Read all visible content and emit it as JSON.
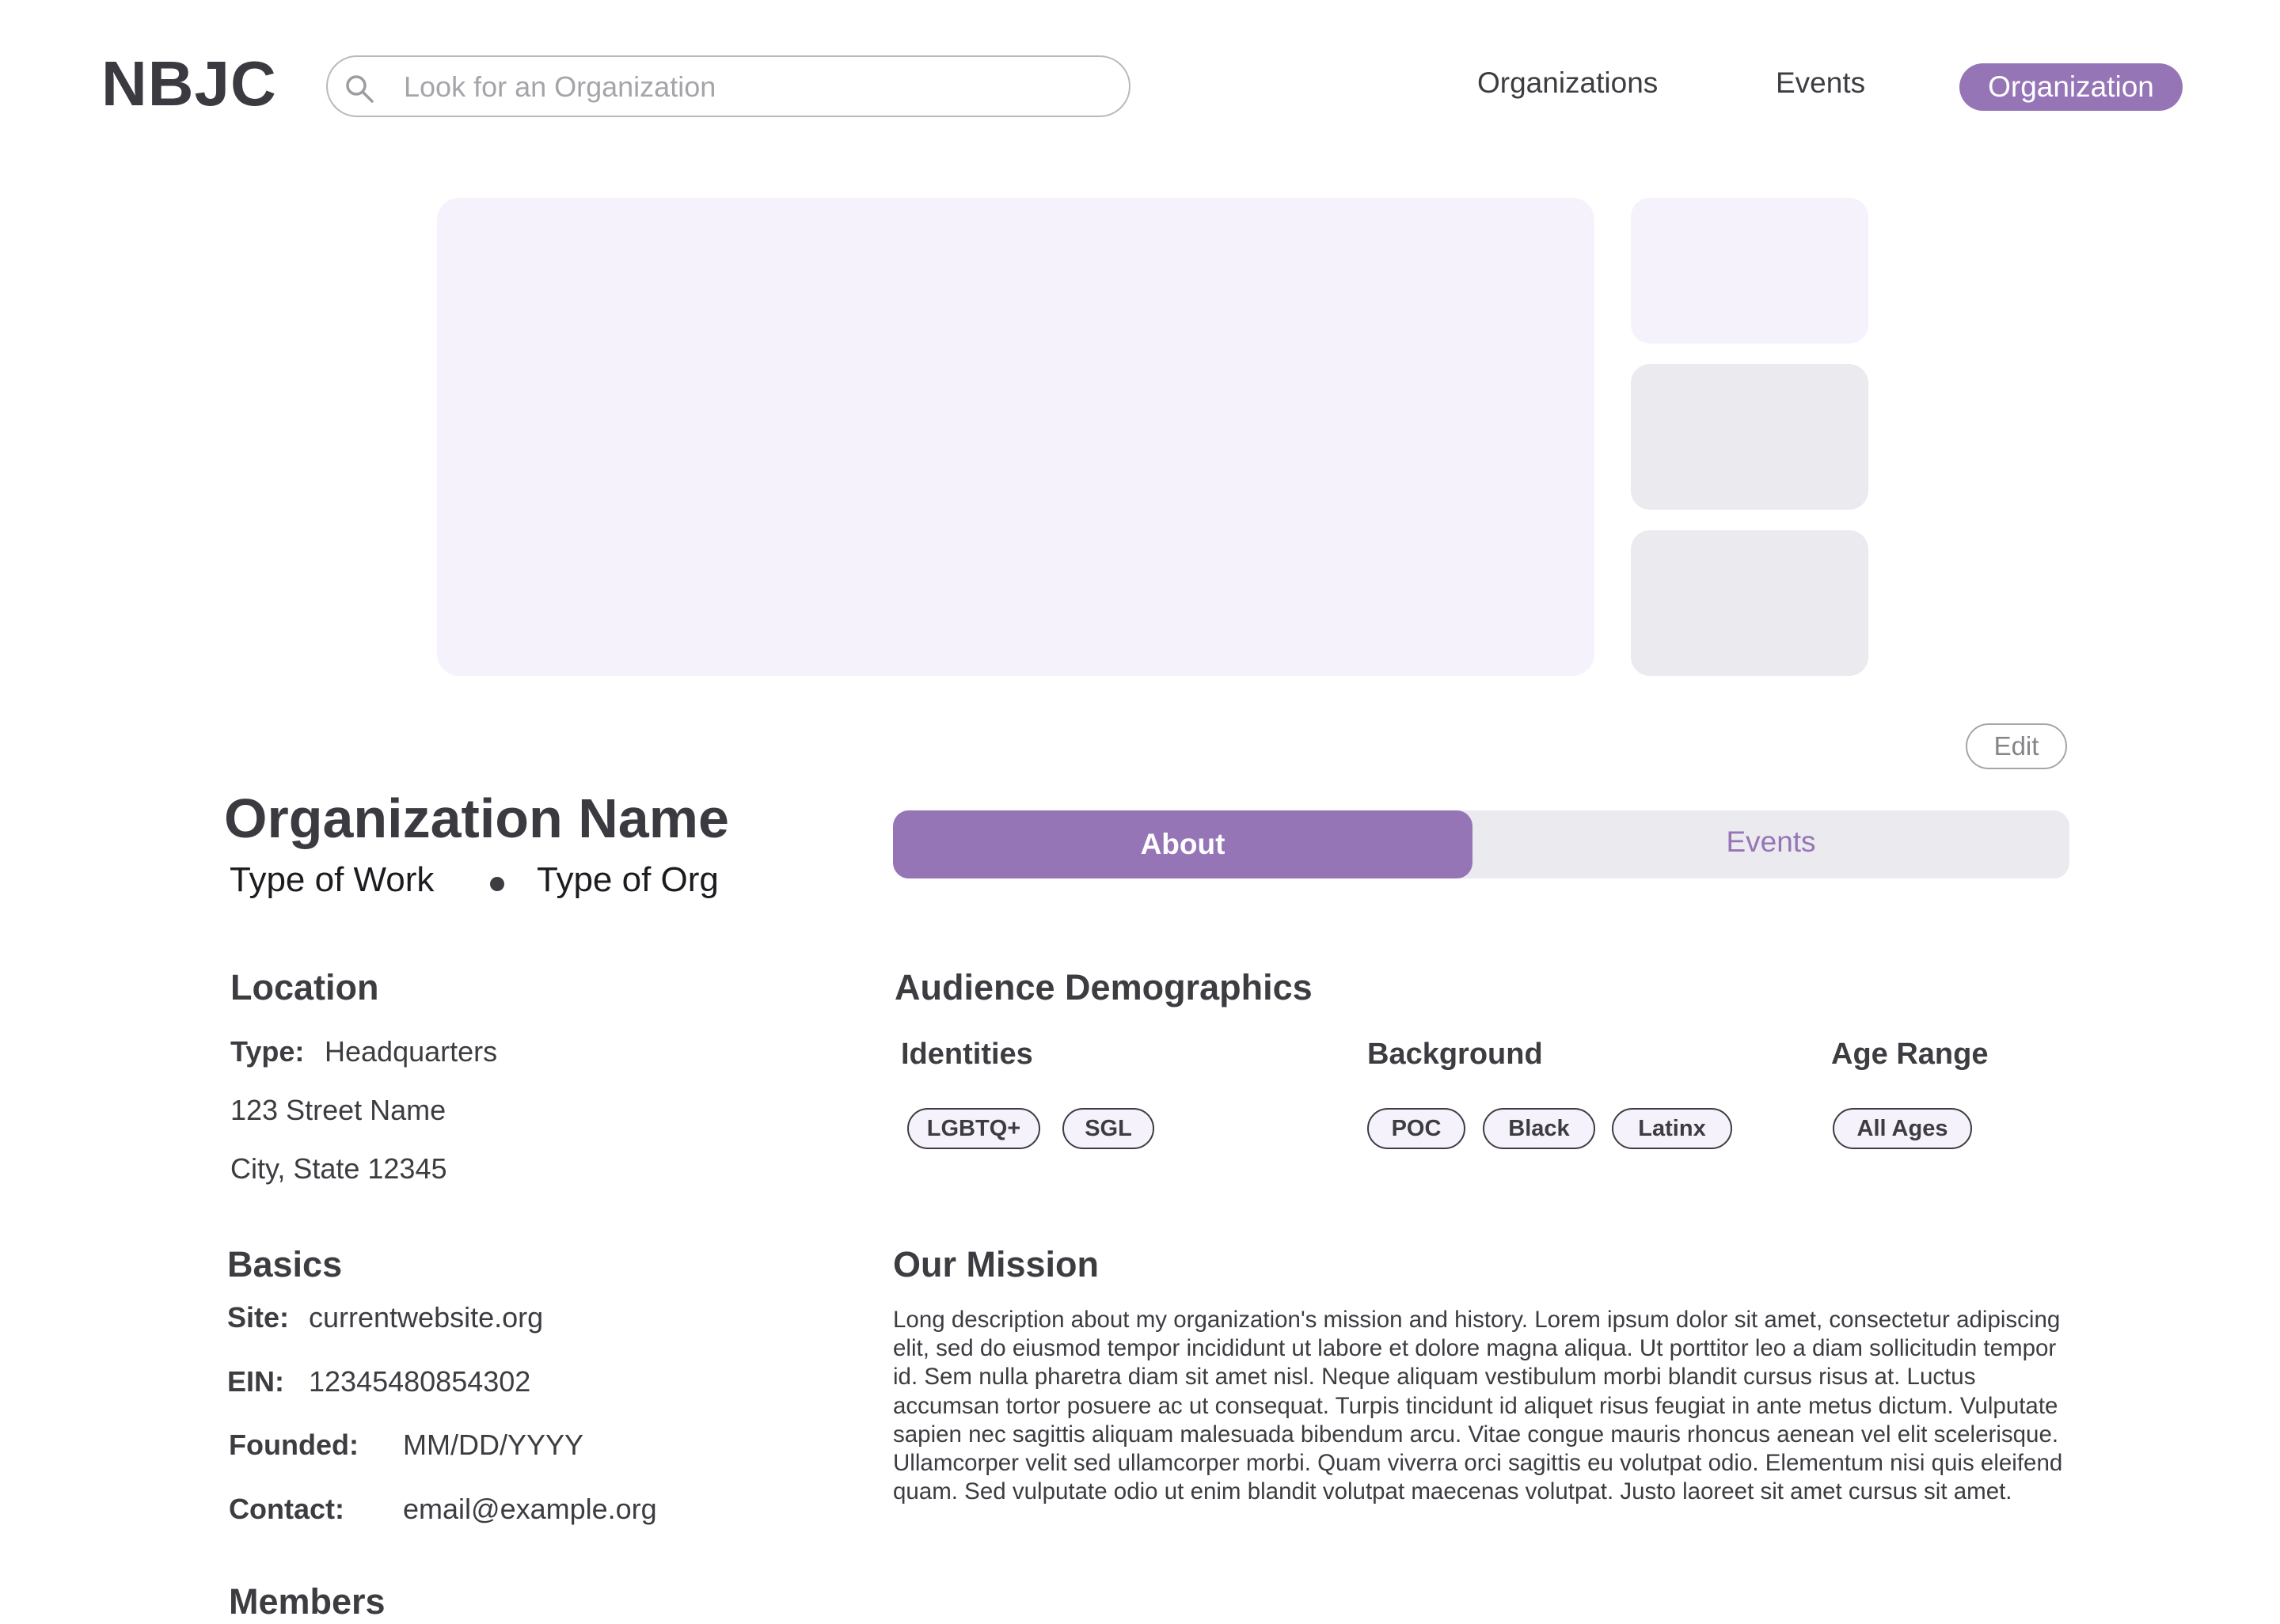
{
  "header": {
    "logo": "NBJC",
    "search_placeholder": "Look for an Organization",
    "nav": [
      "Organizations",
      "Events"
    ],
    "nav_active": "Organization"
  },
  "actions": {
    "edit_label": "Edit"
  },
  "org": {
    "name": "Organization Name",
    "type_of_work": "Type of Work",
    "type_of_org": "Type of Org"
  },
  "location": {
    "heading": "Location",
    "type_label": "Type:",
    "type_value": "Headquarters",
    "street": "123 Street Name",
    "city": "City, State 12345"
  },
  "basics": {
    "heading": "Basics",
    "site_label": "Site:",
    "site_value": "currentwebsite.org",
    "ein_label": "EIN:",
    "ein_value": "12345480854302",
    "founded_label": "Founded:",
    "founded_value": "MM/DD/YYYY",
    "contact_label": "Contact:",
    "contact_value": "email@example.org"
  },
  "members": {
    "heading": "Members"
  },
  "tabs": {
    "active": "About",
    "inactive": "Events"
  },
  "demographics": {
    "heading": "Audience Demographics",
    "identities": {
      "label": "Identities",
      "chips": [
        "LGBTQ+",
        "SGL"
      ]
    },
    "background": {
      "label": "Background",
      "chips": [
        "POC",
        "Black",
        "Latinx"
      ]
    },
    "age_range": {
      "label": "Age Range",
      "chips": [
        "All Ages"
      ]
    }
  },
  "mission": {
    "heading": "Our Mission",
    "text": "Long description about my organization's mission and history. Lorem ipsum dolor sit amet, consectetur adipiscing elit, sed do eiusmod tempor incididunt ut labore et dolore magna aliqua. Ut porttitor leo a diam sollicitudin tempor id. Sem nulla pharetra diam sit amet nisl. Neque aliquam vestibulum morbi blandit cursus risus at. Luctus accumsan tortor posuere ac ut consequat. Turpis tincidunt id aliquet risus feugiat in ante metus dictum. Vulputate sapien nec sagittis aliquam malesuada bibendum arcu. Vitae congue mauris rhoncus aenean vel elit scelerisque. Ullamcorper velit sed ullamcorper morbi. Quam viverra orci sagittis eu volutpat odio. Elementum nisi quis eleifend quam. Sed vulputate odio ut enim blandit volutpat maecenas volutpat. Justo laoreet sit amet cursus sit amet."
  },
  "colors": {
    "accent": "#9675b7",
    "gallery_main": "#f5f2fc",
    "gallery_thumb_light": "#f5f2fc",
    "gallery_thumb_gray": "#ebeaef",
    "text": "#3d3c41"
  }
}
